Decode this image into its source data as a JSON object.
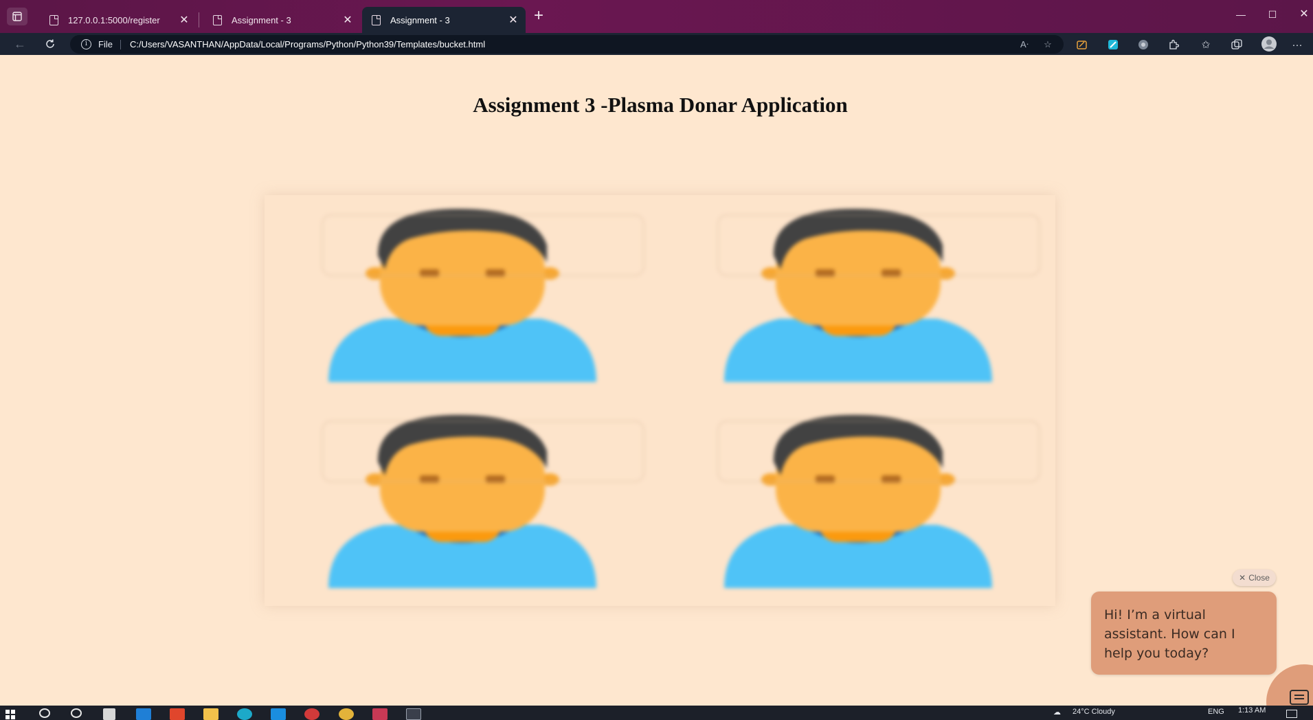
{
  "browser": {
    "tabs": [
      {
        "title": "127.0.0.1:5000/register",
        "active": false
      },
      {
        "title": "Assignment - 3",
        "active": false
      },
      {
        "title": "Assignment - 3",
        "active": true
      }
    ],
    "address": {
      "scheme_label": "File",
      "url": "C:/Users/VASANTHAN/AppData/Local/Programs/Python/Python39/Templates/bucket.html"
    },
    "toolbar_icons": [
      "read-aloud-icon",
      "favorite-add-icon",
      "extension-a-icon",
      "extension-b-icon",
      "extension-c-icon",
      "extensions-icon",
      "favorites-icon",
      "collections-icon",
      "profile-icon",
      "more-icon"
    ]
  },
  "page": {
    "title": "Assignment 3 -Plasma Donar Application",
    "background": "#fee7cf",
    "gallery": {
      "images": [
        {
          "alt": "donor-avatar"
        },
        {
          "alt": "donor-avatar"
        },
        {
          "alt": "donor-avatar"
        },
        {
          "alt": "donor-avatar"
        }
      ]
    }
  },
  "chat": {
    "close_label": "Close",
    "message": "Hi! I’m a virtual assistant. How can I help you today?",
    "accent": "#df9d7a"
  },
  "taskbar": {
    "weather": "24°C Cloudy",
    "language": "ENG",
    "time": "1:13 AM"
  }
}
